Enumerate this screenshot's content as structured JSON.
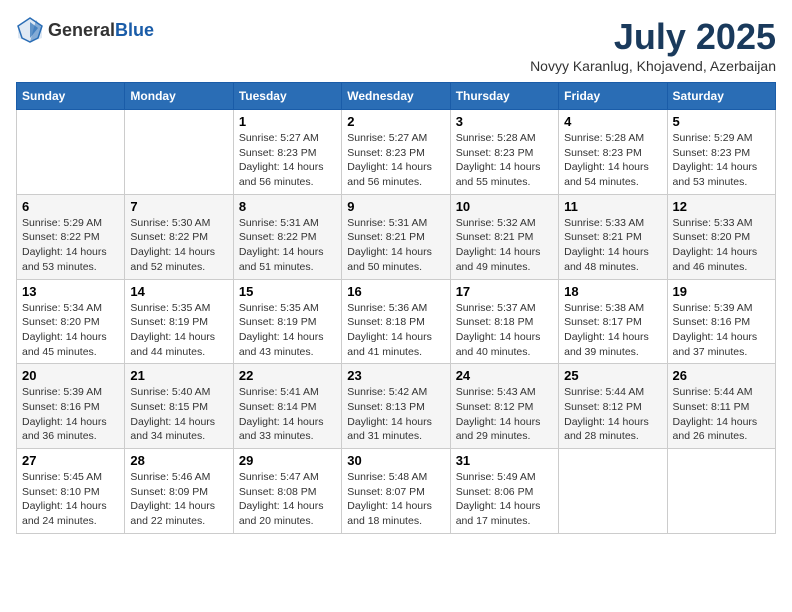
{
  "header": {
    "logo_general": "General",
    "logo_blue": "Blue",
    "title": "July 2025",
    "subtitle": "Novyy Karanlug, Khojavend, Azerbaijan"
  },
  "days_of_week": [
    "Sunday",
    "Monday",
    "Tuesday",
    "Wednesday",
    "Thursday",
    "Friday",
    "Saturday"
  ],
  "weeks": [
    [
      {
        "day": "",
        "sunrise": "",
        "sunset": "",
        "daylight": ""
      },
      {
        "day": "",
        "sunrise": "",
        "sunset": "",
        "daylight": ""
      },
      {
        "day": "1",
        "sunrise": "Sunrise: 5:27 AM",
        "sunset": "Sunset: 8:23 PM",
        "daylight": "Daylight: 14 hours and 56 minutes."
      },
      {
        "day": "2",
        "sunrise": "Sunrise: 5:27 AM",
        "sunset": "Sunset: 8:23 PM",
        "daylight": "Daylight: 14 hours and 56 minutes."
      },
      {
        "day": "3",
        "sunrise": "Sunrise: 5:28 AM",
        "sunset": "Sunset: 8:23 PM",
        "daylight": "Daylight: 14 hours and 55 minutes."
      },
      {
        "day": "4",
        "sunrise": "Sunrise: 5:28 AM",
        "sunset": "Sunset: 8:23 PM",
        "daylight": "Daylight: 14 hours and 54 minutes."
      },
      {
        "day": "5",
        "sunrise": "Sunrise: 5:29 AM",
        "sunset": "Sunset: 8:23 PM",
        "daylight": "Daylight: 14 hours and 53 minutes."
      }
    ],
    [
      {
        "day": "6",
        "sunrise": "Sunrise: 5:29 AM",
        "sunset": "Sunset: 8:22 PM",
        "daylight": "Daylight: 14 hours and 53 minutes."
      },
      {
        "day": "7",
        "sunrise": "Sunrise: 5:30 AM",
        "sunset": "Sunset: 8:22 PM",
        "daylight": "Daylight: 14 hours and 52 minutes."
      },
      {
        "day": "8",
        "sunrise": "Sunrise: 5:31 AM",
        "sunset": "Sunset: 8:22 PM",
        "daylight": "Daylight: 14 hours and 51 minutes."
      },
      {
        "day": "9",
        "sunrise": "Sunrise: 5:31 AM",
        "sunset": "Sunset: 8:21 PM",
        "daylight": "Daylight: 14 hours and 50 minutes."
      },
      {
        "day": "10",
        "sunrise": "Sunrise: 5:32 AM",
        "sunset": "Sunset: 8:21 PM",
        "daylight": "Daylight: 14 hours and 49 minutes."
      },
      {
        "day": "11",
        "sunrise": "Sunrise: 5:33 AM",
        "sunset": "Sunset: 8:21 PM",
        "daylight": "Daylight: 14 hours and 48 minutes."
      },
      {
        "day": "12",
        "sunrise": "Sunrise: 5:33 AM",
        "sunset": "Sunset: 8:20 PM",
        "daylight": "Daylight: 14 hours and 46 minutes."
      }
    ],
    [
      {
        "day": "13",
        "sunrise": "Sunrise: 5:34 AM",
        "sunset": "Sunset: 8:20 PM",
        "daylight": "Daylight: 14 hours and 45 minutes."
      },
      {
        "day": "14",
        "sunrise": "Sunrise: 5:35 AM",
        "sunset": "Sunset: 8:19 PM",
        "daylight": "Daylight: 14 hours and 44 minutes."
      },
      {
        "day": "15",
        "sunrise": "Sunrise: 5:35 AM",
        "sunset": "Sunset: 8:19 PM",
        "daylight": "Daylight: 14 hours and 43 minutes."
      },
      {
        "day": "16",
        "sunrise": "Sunrise: 5:36 AM",
        "sunset": "Sunset: 8:18 PM",
        "daylight": "Daylight: 14 hours and 41 minutes."
      },
      {
        "day": "17",
        "sunrise": "Sunrise: 5:37 AM",
        "sunset": "Sunset: 8:18 PM",
        "daylight": "Daylight: 14 hours and 40 minutes."
      },
      {
        "day": "18",
        "sunrise": "Sunrise: 5:38 AM",
        "sunset": "Sunset: 8:17 PM",
        "daylight": "Daylight: 14 hours and 39 minutes."
      },
      {
        "day": "19",
        "sunrise": "Sunrise: 5:39 AM",
        "sunset": "Sunset: 8:16 PM",
        "daylight": "Daylight: 14 hours and 37 minutes."
      }
    ],
    [
      {
        "day": "20",
        "sunrise": "Sunrise: 5:39 AM",
        "sunset": "Sunset: 8:16 PM",
        "daylight": "Daylight: 14 hours and 36 minutes."
      },
      {
        "day": "21",
        "sunrise": "Sunrise: 5:40 AM",
        "sunset": "Sunset: 8:15 PM",
        "daylight": "Daylight: 14 hours and 34 minutes."
      },
      {
        "day": "22",
        "sunrise": "Sunrise: 5:41 AM",
        "sunset": "Sunset: 8:14 PM",
        "daylight": "Daylight: 14 hours and 33 minutes."
      },
      {
        "day": "23",
        "sunrise": "Sunrise: 5:42 AM",
        "sunset": "Sunset: 8:13 PM",
        "daylight": "Daylight: 14 hours and 31 minutes."
      },
      {
        "day": "24",
        "sunrise": "Sunrise: 5:43 AM",
        "sunset": "Sunset: 8:12 PM",
        "daylight": "Daylight: 14 hours and 29 minutes."
      },
      {
        "day": "25",
        "sunrise": "Sunrise: 5:44 AM",
        "sunset": "Sunset: 8:12 PM",
        "daylight": "Daylight: 14 hours and 28 minutes."
      },
      {
        "day": "26",
        "sunrise": "Sunrise: 5:44 AM",
        "sunset": "Sunset: 8:11 PM",
        "daylight": "Daylight: 14 hours and 26 minutes."
      }
    ],
    [
      {
        "day": "27",
        "sunrise": "Sunrise: 5:45 AM",
        "sunset": "Sunset: 8:10 PM",
        "daylight": "Daylight: 14 hours and 24 minutes."
      },
      {
        "day": "28",
        "sunrise": "Sunrise: 5:46 AM",
        "sunset": "Sunset: 8:09 PM",
        "daylight": "Daylight: 14 hours and 22 minutes."
      },
      {
        "day": "29",
        "sunrise": "Sunrise: 5:47 AM",
        "sunset": "Sunset: 8:08 PM",
        "daylight": "Daylight: 14 hours and 20 minutes."
      },
      {
        "day": "30",
        "sunrise": "Sunrise: 5:48 AM",
        "sunset": "Sunset: 8:07 PM",
        "daylight": "Daylight: 14 hours and 18 minutes."
      },
      {
        "day": "31",
        "sunrise": "Sunrise: 5:49 AM",
        "sunset": "Sunset: 8:06 PM",
        "daylight": "Daylight: 14 hours and 17 minutes."
      },
      {
        "day": "",
        "sunrise": "",
        "sunset": "",
        "daylight": ""
      },
      {
        "day": "",
        "sunrise": "",
        "sunset": "",
        "daylight": ""
      }
    ]
  ]
}
